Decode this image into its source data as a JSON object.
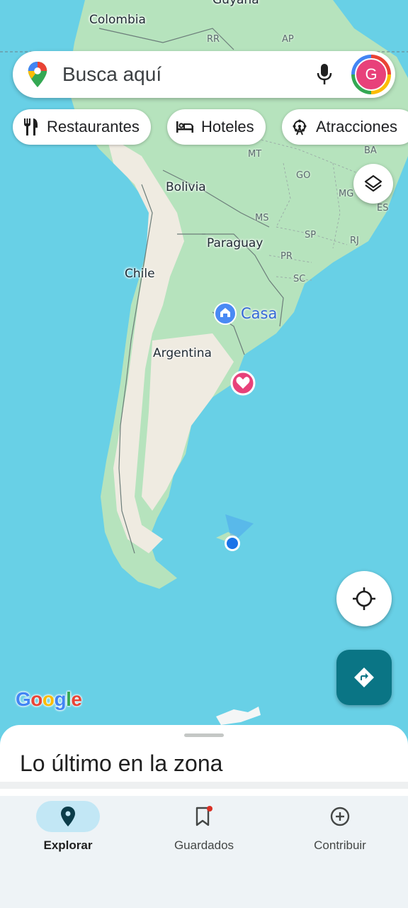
{
  "search": {
    "placeholder": "Busca aquí",
    "avatar_letter": "G"
  },
  "chips": [
    {
      "label": "Restaurantes",
      "icon": "fork-knife-icon"
    },
    {
      "label": "Hoteles",
      "icon": "bed-icon"
    },
    {
      "label": "Atracciones",
      "icon": "ferris-wheel-icon"
    }
  ],
  "map": {
    "countries": [
      "Colombia",
      "Bolivia",
      "Paraguay",
      "Chile",
      "Argentina",
      "Guyana"
    ],
    "regions": [
      "RR",
      "AP",
      "MT",
      "BA",
      "GO",
      "MG",
      "ES",
      "MS",
      "SP",
      "RJ",
      "PR",
      "SC"
    ],
    "places": {
      "home": "Casa"
    },
    "colors": {
      "water": "#68d0e6",
      "land": "#b6e3bd",
      "dry_land": "#efebe1",
      "home_pin": "#4a8af4",
      "saved_pin": "#e8417a",
      "location_dot": "#1a73e8"
    },
    "attribution": "Google"
  },
  "sheet": {
    "title": "Lo último en la zona"
  },
  "nav": [
    {
      "label": "Explorar",
      "icon": "explore-pin-icon",
      "active": true
    },
    {
      "label": "Guardados",
      "icon": "bookmark-icon",
      "active": false,
      "badge": true
    },
    {
      "label": "Contribuir",
      "icon": "add-circle-icon",
      "active": false
    }
  ]
}
